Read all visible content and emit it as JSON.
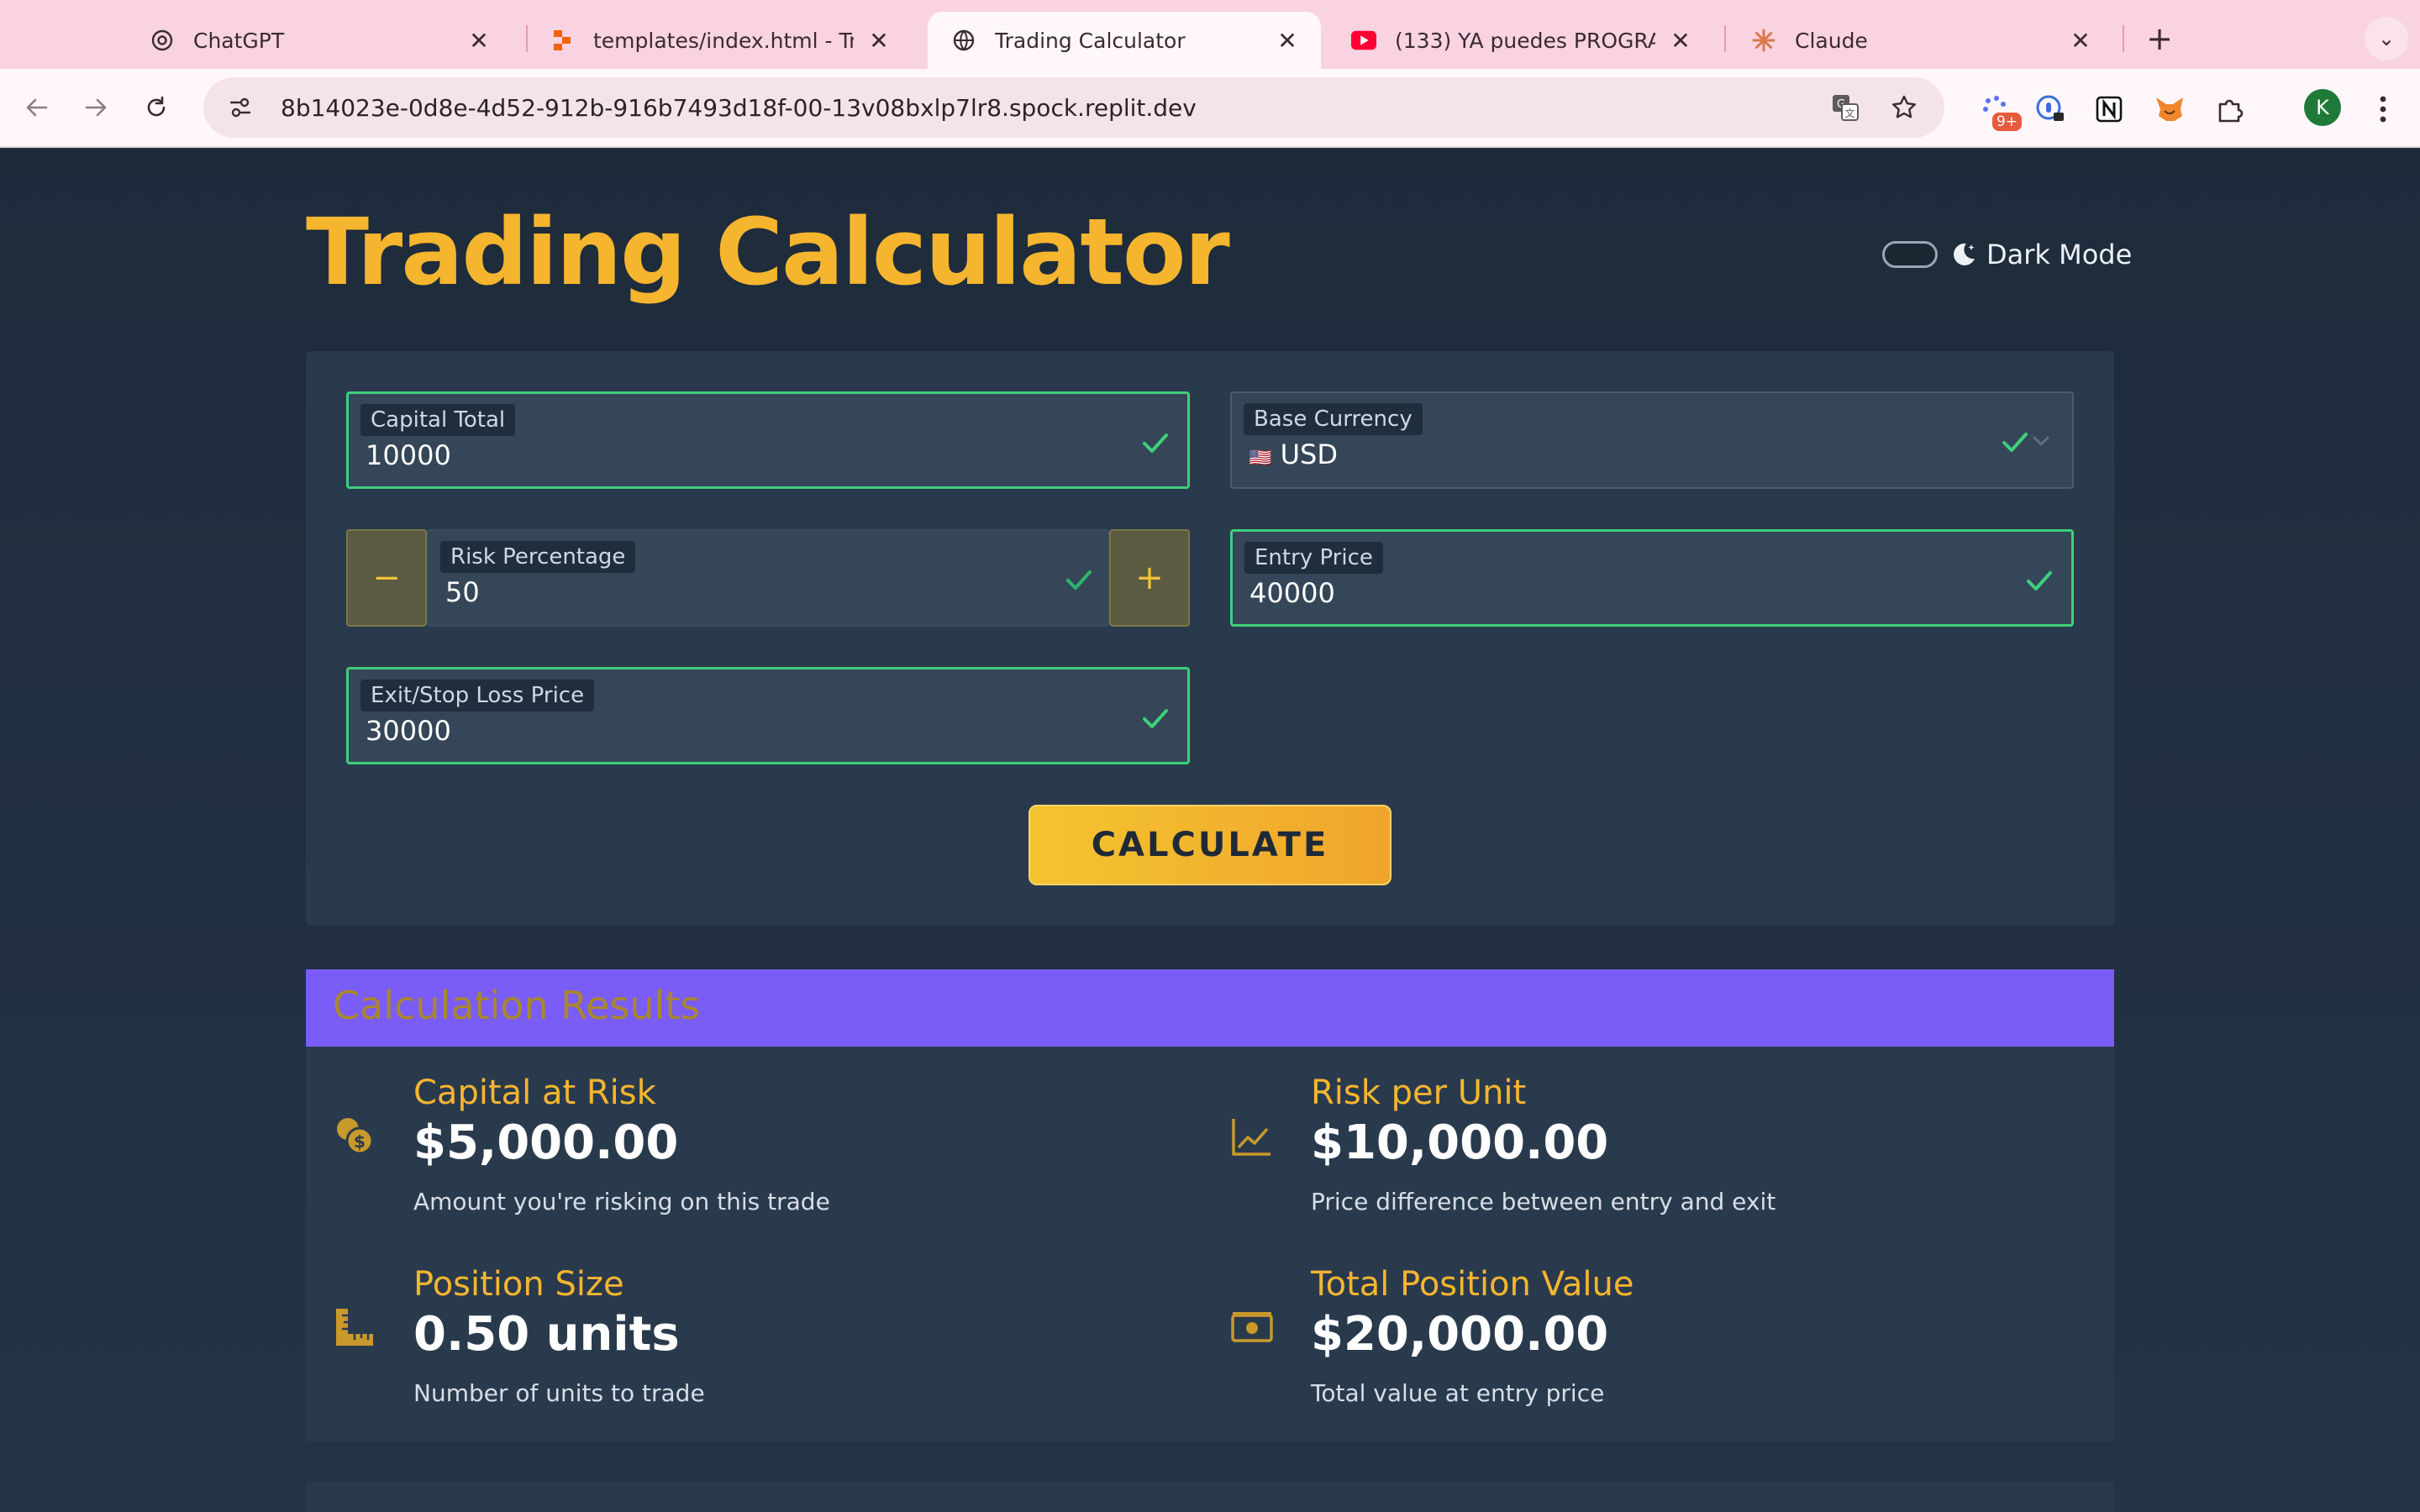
{
  "browser": {
    "tabs": [
      {
        "title": "ChatGPT",
        "icon": "chatgpt-icon"
      },
      {
        "title": "templates/index.html - Trading",
        "icon": "replit-icon"
      },
      {
        "title": "Trading Calculator",
        "icon": "globe-icon",
        "active": true
      },
      {
        "title": "(133) YA puedes PROGRAMAR",
        "icon": "youtube-icon"
      },
      {
        "title": "Claude",
        "icon": "claude-icon"
      }
    ],
    "close_glyph": "✕",
    "new_tab_glyph": "+",
    "tab_menu_glyph": "⌄",
    "url": "8b14023e-0d8e-4d52-912b-916b7493d18f-00-13v08bxlp7lr8.spock.replit.dev",
    "extension_badge": "9+",
    "profile_initial": "K"
  },
  "app": {
    "title": "Trading Calculator",
    "dark_mode_label": "Dark Mode",
    "accent_color": "#f5b52e"
  },
  "form": {
    "capital_total": {
      "label": "Capital Total",
      "value": "10000"
    },
    "base_currency": {
      "label": "Base Currency",
      "flag": "🇺🇸",
      "value": "USD"
    },
    "risk_percentage": {
      "label": "Risk Percentage",
      "value": "50",
      "minus": "−",
      "plus": "+"
    },
    "entry_price": {
      "label": "Entry Price",
      "value": "40000"
    },
    "exit_price": {
      "label": "Exit/Stop Loss Price",
      "value": "30000"
    },
    "calculate_label": "CALCULATE"
  },
  "results": {
    "title": "Calculation Results",
    "metrics": [
      {
        "label": "Capital at Risk",
        "value": "$5,000.00",
        "desc": "Amount you're risking on this trade",
        "icon": "coins-icon"
      },
      {
        "label": "Risk per Unit",
        "value": "$10,000.00",
        "desc": "Price difference between entry and exit",
        "icon": "line-chart-icon"
      },
      {
        "label": "Position Size",
        "value": "0.50 units",
        "desc": "Number of units to trade",
        "icon": "ruler-icon"
      },
      {
        "label": "Total Position Value",
        "value": "$20,000.00",
        "desc": "Total value at entry price",
        "icon": "money-bill-icon"
      }
    ]
  }
}
